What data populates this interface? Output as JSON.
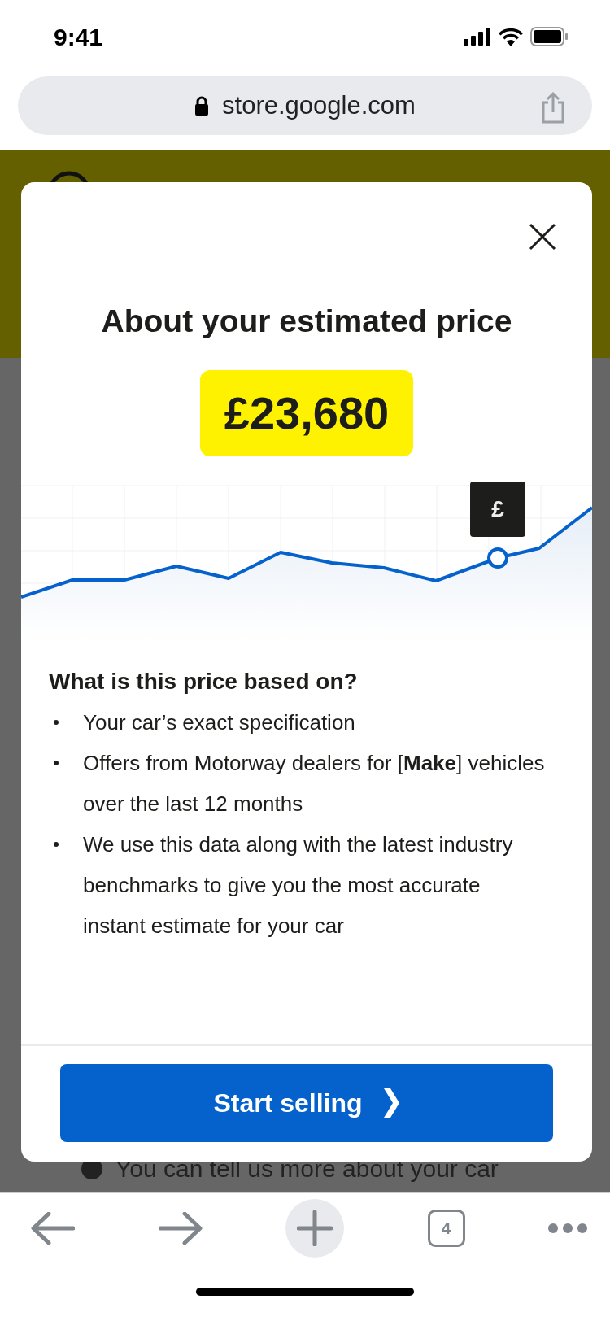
{
  "status_bar": {
    "time": "9:41"
  },
  "address_bar": {
    "url": "store.google.com"
  },
  "background_page": {
    "text": "You can tell us more about your car"
  },
  "modal": {
    "title": "About your estimated price",
    "price": "£23,680",
    "chart": {
      "kind": "picture",
      "tooltip": "£"
    },
    "heading": "What is this price based on?",
    "bullets": [
      "Your car’s exact specification",
      "Offers from Motorway dealers for [**Make**] vehicles over the last 12 months",
      "We use this data along with the latest industry benchmarks to give you the most accurate instant estimate for your car"
    ],
    "button": {
      "label": "Start selling"
    }
  },
  "toolbar": {
    "tab_count": "4"
  }
}
